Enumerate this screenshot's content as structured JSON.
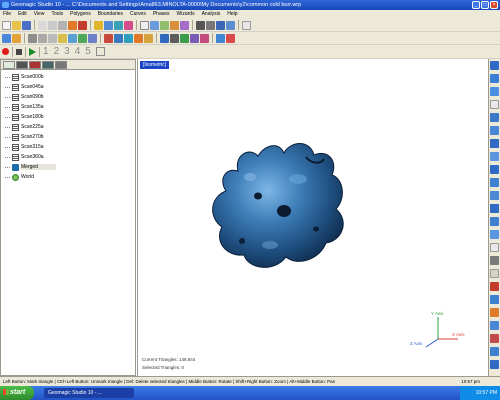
{
  "window": {
    "title": "Geomagic Studio 10 - ... C:\\Documents and Settings\\Ama863.MINOLTA-0000\\My Documents\\y2\\common cold burr.wrp"
  },
  "menu": [
    "File",
    "Edit",
    "View",
    "Tools",
    "Polygons",
    "Boundaries",
    "Curves",
    "Phases",
    "Wizards",
    "Analysis",
    "Help"
  ],
  "toolbar3": {
    "numbers": [
      "1",
      "2",
      "3",
      "4",
      "5"
    ]
  },
  "model_tree": {
    "items": [
      {
        "label": "Scan000b",
        "icon": "scan-icon"
      },
      {
        "label": "Scan045a",
        "icon": "scan-icon"
      },
      {
        "label": "Scan090b",
        "icon": "scan-icon"
      },
      {
        "label": "Scan135a",
        "icon": "scan-icon"
      },
      {
        "label": "Scan180b",
        "icon": "scan-icon"
      },
      {
        "label": "Scan225a",
        "icon": "scan-icon"
      },
      {
        "label": "Scan270b",
        "icon": "scan-icon"
      },
      {
        "label": "Scan315a",
        "icon": "scan-icon"
      },
      {
        "label": "Scan360a",
        "icon": "scan-icon"
      },
      {
        "label": "Merged",
        "icon": "merged-icon",
        "selected": true
      },
      {
        "label": "World",
        "icon": "world-icon"
      }
    ]
  },
  "viewport": {
    "tab_label": "[Isometric]",
    "current_triangles": "Current Triangles: 148,944",
    "selected_triangles": "Selected Triangles: 0",
    "axis_labels": {
      "y": "Y Axis",
      "z": "Z Axis",
      "x": "X Axis"
    }
  },
  "statusbar": {
    "hint": "Left Button: Mark triangle | Ctrl+Left Button: Unmark triangle | Del: Delete selected triangles | Middle Button: Rotate | Shift+Right Button: Zoom | Alt+Middle Button: Pan",
    "time": "10:57 pm"
  },
  "taskbar": {
    "start_label": "start",
    "task_label": "Geomagic Studio 10 - ...",
    "clock": "10:57 PM"
  },
  "colors": {
    "titlebar": "#1747b8",
    "chrome": "#ece9d8",
    "model": "#2b5f8e",
    "taskbar": "#2153c7"
  }
}
